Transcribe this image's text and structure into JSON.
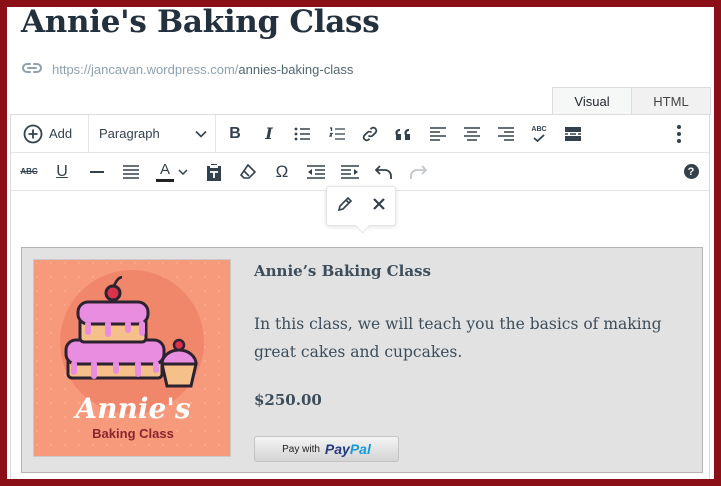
{
  "page": {
    "title": "Annie's Baking Class",
    "permalink_base": "https://jancavan.wordpress.com/",
    "permalink_slug": "annies-baking-class"
  },
  "editor_tabs": [
    {
      "label": "Visual",
      "active": true
    },
    {
      "label": "HTML",
      "active": false
    }
  ],
  "toolbar": {
    "add_label": "Add",
    "format_select": "Paragraph",
    "row1_icons": [
      "bold-icon",
      "italic-icon",
      "bulleted-list-icon",
      "numbered-list-icon",
      "link-icon",
      "blockquote-icon",
      "align-left-icon",
      "align-center-icon",
      "align-right-icon",
      "spellcheck-icon",
      "read-more-icon",
      "more-options-icon"
    ],
    "row2_icons": [
      "strikethrough-icon",
      "underline-icon",
      "horizontal-line-icon",
      "justify-icon",
      "text-color-icon",
      "paste-as-text-icon",
      "clear-formatting-icon",
      "special-character-icon",
      "outdent-icon",
      "indent-icon",
      "undo-icon",
      "redo-icon",
      "help-icon"
    ],
    "bold_glyph": "B",
    "italic_glyph": "I",
    "underline_glyph": "U",
    "strike_glyph": "ABC",
    "spell_glyph": "ABC",
    "omega_glyph": "Ω",
    "text_color_glyph": "A",
    "help_glyph": "?"
  },
  "popover": {
    "icons": [
      "edit-pencil-icon",
      "remove-x-icon"
    ]
  },
  "product": {
    "name": "Annie’s Baking Class",
    "description": "In this class, we will teach you the basics of making great cakes and cupcakes.",
    "price": "$250.00",
    "image_logo_text": "Annie's",
    "image_sub_text": "Baking Class",
    "paypal_prefix": "Pay with",
    "paypal_pay": "Pay",
    "paypal_pal": "Pal"
  },
  "colors": {
    "frame": "#8b0f17",
    "title": "#23303d",
    "product_bg": "#e2e2e2",
    "image_bg": "#f79a7c",
    "paypal_dark": "#253b80",
    "paypal_light": "#179bd7"
  }
}
